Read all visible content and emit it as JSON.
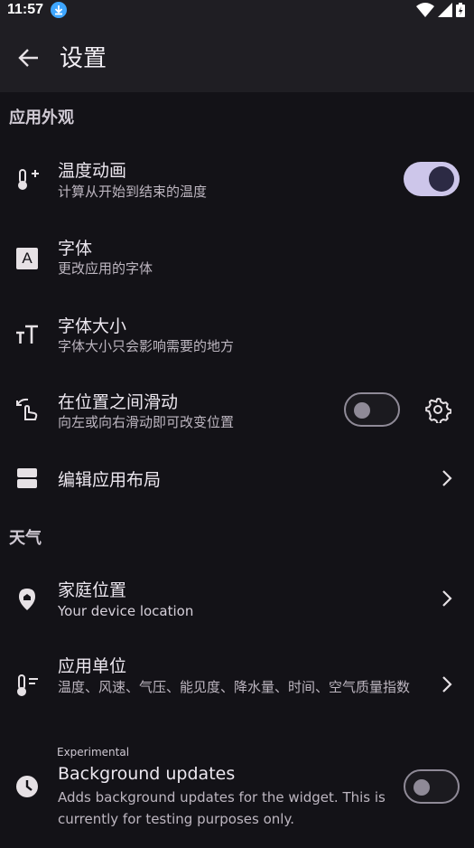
{
  "status_bar": {
    "time": "11:57"
  },
  "app_bar": {
    "title": "设置"
  },
  "sections": {
    "appearance": "应用外观",
    "weather": "天气"
  },
  "settings": {
    "temp_anim": {
      "title": "温度动画",
      "subtitle": "计算从开始到结束的温度",
      "enabled": true
    },
    "font": {
      "title": "字体",
      "subtitle": "更改应用的字体",
      "icon_letter": "A"
    },
    "font_size": {
      "title": "字体大小",
      "subtitle": "字体大小只会影响需要的地方"
    },
    "swipe": {
      "title": "在位置之间滑动",
      "subtitle": "向左或向右滑动即可改变位置",
      "enabled": false
    },
    "edit_layout": {
      "title": "编辑应用布局"
    },
    "home_location": {
      "title": "家庭位置",
      "subtitle": "Your device location"
    },
    "units": {
      "title": "应用单位",
      "subtitle": "温度、风速、气压、能见度、降水量、时间、空气质量指数"
    },
    "background": {
      "badge": "Experimental",
      "title": "Background updates",
      "subtitle": "Adds background updates for the widget. This is currently for testing purposes only.",
      "enabled": false
    }
  },
  "colors": {
    "background": "#131217",
    "toggle_on_track": "#cdc6ea",
    "toggle_on_knob": "#2c2a44",
    "toggle_off_outline": "#8f8a97"
  }
}
